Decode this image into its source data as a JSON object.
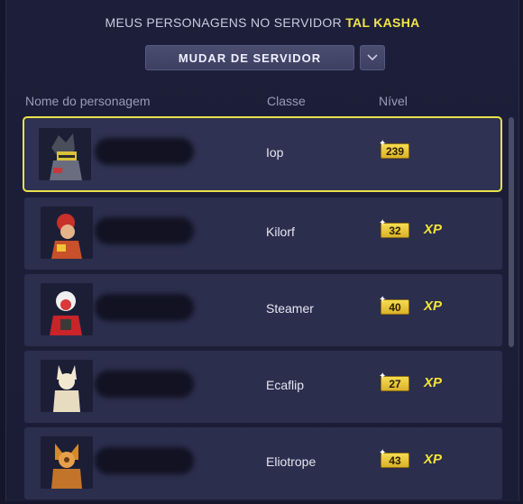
{
  "header": {
    "prefix": "MEUS PERSONAGENS NO SERVIDOR",
    "server_name": "TAL KASHA"
  },
  "server_controls": {
    "change_server_label": "MUDAR DE SERVIDOR",
    "dropdown_icon": "chevron-down-icon"
  },
  "columns": {
    "name": "Nome do personagem",
    "class": "Classe",
    "level": "Nível"
  },
  "characters": [
    {
      "class": "Iop",
      "level": "239",
      "xp_label": "",
      "selected": true
    },
    {
      "class": "Kilorf",
      "level": "32",
      "xp_label": "XP",
      "selected": false
    },
    {
      "class": "Steamer",
      "level": "40",
      "xp_label": "XP",
      "selected": false
    },
    {
      "class": "Ecaflip",
      "level": "27",
      "xp_label": "XP",
      "selected": false
    },
    {
      "class": "Eliotrope",
      "level": "43",
      "xp_label": "XP",
      "selected": false
    }
  ],
  "colors": {
    "accent": "#e9e24b",
    "server_name": "#f2e54a",
    "panel_bg": "#1d1f3a",
    "row_bg": "#2b2e4d"
  }
}
